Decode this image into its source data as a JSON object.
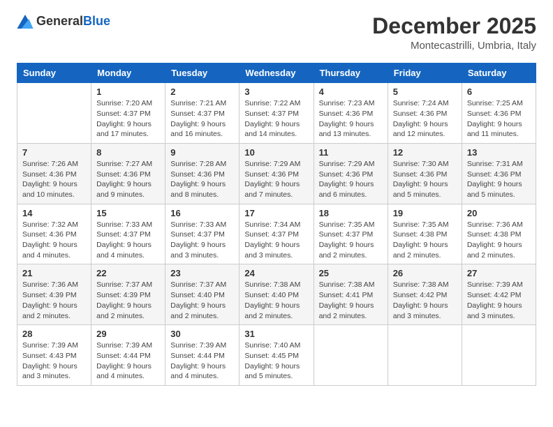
{
  "header": {
    "logo": {
      "general": "General",
      "blue": "Blue"
    },
    "title": "December 2025",
    "location": "Montecastrilli, Umbria, Italy"
  },
  "weekdays": [
    "Sunday",
    "Monday",
    "Tuesday",
    "Wednesday",
    "Thursday",
    "Friday",
    "Saturday"
  ],
  "weeks": [
    [
      {
        "day": "",
        "info": ""
      },
      {
        "day": "1",
        "info": "Sunrise: 7:20 AM\nSunset: 4:37 PM\nDaylight: 9 hours\nand 17 minutes."
      },
      {
        "day": "2",
        "info": "Sunrise: 7:21 AM\nSunset: 4:37 PM\nDaylight: 9 hours\nand 16 minutes."
      },
      {
        "day": "3",
        "info": "Sunrise: 7:22 AM\nSunset: 4:37 PM\nDaylight: 9 hours\nand 14 minutes."
      },
      {
        "day": "4",
        "info": "Sunrise: 7:23 AM\nSunset: 4:36 PM\nDaylight: 9 hours\nand 13 minutes."
      },
      {
        "day": "5",
        "info": "Sunrise: 7:24 AM\nSunset: 4:36 PM\nDaylight: 9 hours\nand 12 minutes."
      },
      {
        "day": "6",
        "info": "Sunrise: 7:25 AM\nSunset: 4:36 PM\nDaylight: 9 hours\nand 11 minutes."
      }
    ],
    [
      {
        "day": "7",
        "info": "Sunrise: 7:26 AM\nSunset: 4:36 PM\nDaylight: 9 hours\nand 10 minutes."
      },
      {
        "day": "8",
        "info": "Sunrise: 7:27 AM\nSunset: 4:36 PM\nDaylight: 9 hours\nand 9 minutes."
      },
      {
        "day": "9",
        "info": "Sunrise: 7:28 AM\nSunset: 4:36 PM\nDaylight: 9 hours\nand 8 minutes."
      },
      {
        "day": "10",
        "info": "Sunrise: 7:29 AM\nSunset: 4:36 PM\nDaylight: 9 hours\nand 7 minutes."
      },
      {
        "day": "11",
        "info": "Sunrise: 7:29 AM\nSunset: 4:36 PM\nDaylight: 9 hours\nand 6 minutes."
      },
      {
        "day": "12",
        "info": "Sunrise: 7:30 AM\nSunset: 4:36 PM\nDaylight: 9 hours\nand 5 minutes."
      },
      {
        "day": "13",
        "info": "Sunrise: 7:31 AM\nSunset: 4:36 PM\nDaylight: 9 hours\nand 5 minutes."
      }
    ],
    [
      {
        "day": "14",
        "info": "Sunrise: 7:32 AM\nSunset: 4:36 PM\nDaylight: 9 hours\nand 4 minutes."
      },
      {
        "day": "15",
        "info": "Sunrise: 7:33 AM\nSunset: 4:37 PM\nDaylight: 9 hours\nand 4 minutes."
      },
      {
        "day": "16",
        "info": "Sunrise: 7:33 AM\nSunset: 4:37 PM\nDaylight: 9 hours\nand 3 minutes."
      },
      {
        "day": "17",
        "info": "Sunrise: 7:34 AM\nSunset: 4:37 PM\nDaylight: 9 hours\nand 3 minutes."
      },
      {
        "day": "18",
        "info": "Sunrise: 7:35 AM\nSunset: 4:37 PM\nDaylight: 9 hours\nand 2 minutes."
      },
      {
        "day": "19",
        "info": "Sunrise: 7:35 AM\nSunset: 4:38 PM\nDaylight: 9 hours\nand 2 minutes."
      },
      {
        "day": "20",
        "info": "Sunrise: 7:36 AM\nSunset: 4:38 PM\nDaylight: 9 hours\nand 2 minutes."
      }
    ],
    [
      {
        "day": "21",
        "info": "Sunrise: 7:36 AM\nSunset: 4:39 PM\nDaylight: 9 hours\nand 2 minutes."
      },
      {
        "day": "22",
        "info": "Sunrise: 7:37 AM\nSunset: 4:39 PM\nDaylight: 9 hours\nand 2 minutes."
      },
      {
        "day": "23",
        "info": "Sunrise: 7:37 AM\nSunset: 4:40 PM\nDaylight: 9 hours\nand 2 minutes."
      },
      {
        "day": "24",
        "info": "Sunrise: 7:38 AM\nSunset: 4:40 PM\nDaylight: 9 hours\nand 2 minutes."
      },
      {
        "day": "25",
        "info": "Sunrise: 7:38 AM\nSunset: 4:41 PM\nDaylight: 9 hours\nand 2 minutes."
      },
      {
        "day": "26",
        "info": "Sunrise: 7:38 AM\nSunset: 4:42 PM\nDaylight: 9 hours\nand 3 minutes."
      },
      {
        "day": "27",
        "info": "Sunrise: 7:39 AM\nSunset: 4:42 PM\nDaylight: 9 hours\nand 3 minutes."
      }
    ],
    [
      {
        "day": "28",
        "info": "Sunrise: 7:39 AM\nSunset: 4:43 PM\nDaylight: 9 hours\nand 3 minutes."
      },
      {
        "day": "29",
        "info": "Sunrise: 7:39 AM\nSunset: 4:44 PM\nDaylight: 9 hours\nand 4 minutes."
      },
      {
        "day": "30",
        "info": "Sunrise: 7:39 AM\nSunset: 4:44 PM\nDaylight: 9 hours\nand 4 minutes."
      },
      {
        "day": "31",
        "info": "Sunrise: 7:40 AM\nSunset: 4:45 PM\nDaylight: 9 hours\nand 5 minutes."
      },
      {
        "day": "",
        "info": ""
      },
      {
        "day": "",
        "info": ""
      },
      {
        "day": "",
        "info": ""
      }
    ]
  ]
}
